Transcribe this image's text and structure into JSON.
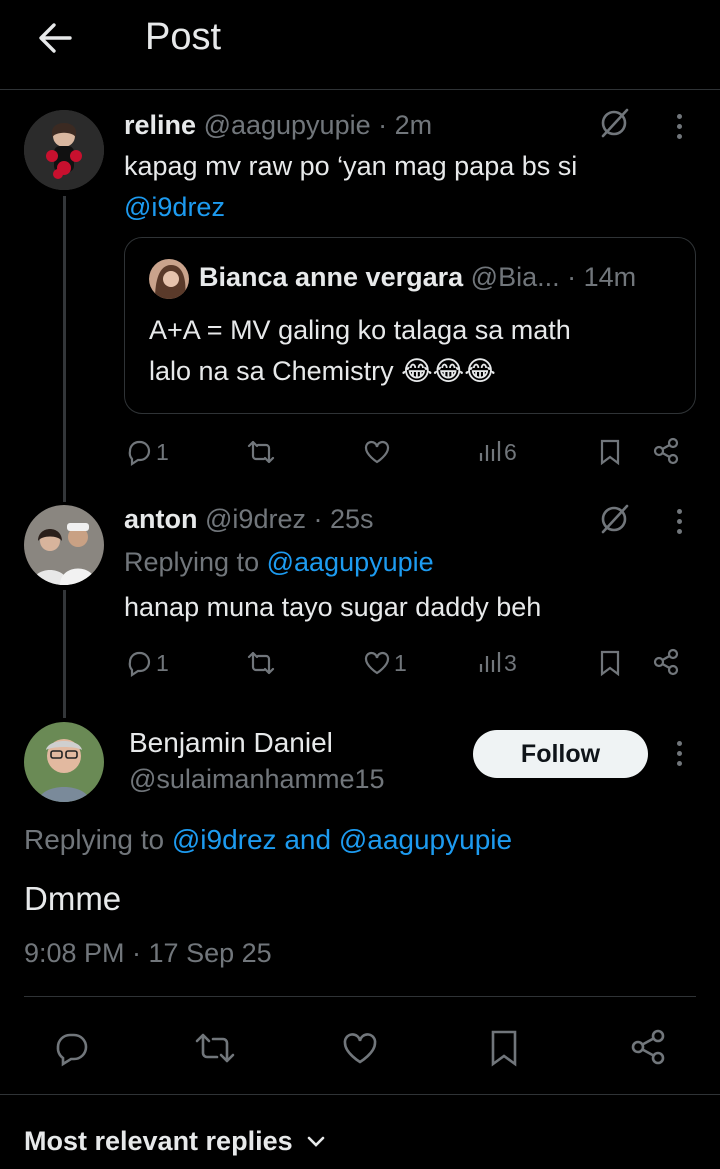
{
  "header": {
    "title": "Post"
  },
  "reply1": {
    "display_name": "reline",
    "handle": "@aagupyupie",
    "time": "· 2m",
    "text_line1": "kapag mv raw po ‘yan mag papa bs si",
    "mention": "@i9drez",
    "quote": {
      "display_name": "Bianca anne vergara",
      "handle": "@Bia...",
      "time": "· 14m",
      "text_line1": "A+A = MV galing ko talaga sa math",
      "text_line2": "lalo na sa Chemistry 😂😂😂"
    },
    "actions": {
      "replies": "1",
      "reposts": "",
      "likes": "",
      "views": "6"
    }
  },
  "reply2": {
    "display_name": "anton",
    "handle": "@i9drez",
    "time": "· 25s",
    "replying_prefix": "Replying to",
    "replying_to": "@aagupyupie",
    "text": "hanap muna tayo sugar daddy beh",
    "actions": {
      "replies": "1",
      "reposts": "",
      "likes": "1",
      "views": "3"
    }
  },
  "main": {
    "display_name": "Benjamin Daniel",
    "handle": "@sulaimanhamme15",
    "follow_label": "Follow",
    "replying_prefix": "Replying to",
    "replying_to": "@i9drez and @aagupyupie",
    "text": "Dmme",
    "timestamp": "9:08 PM · 17 Sep 25"
  },
  "footer": {
    "sort_label": "Most relevant replies"
  },
  "colors": {
    "background": "#000000",
    "text": "#e7e9ea",
    "muted": "#71767b",
    "link": "#1d9bf0",
    "border": "#2f3336"
  },
  "icons": [
    "back-arrow-icon",
    "grok-icon",
    "more-icon",
    "reply-icon",
    "repost-icon",
    "like-icon",
    "views-icon",
    "bookmark-icon",
    "share-icon",
    "chevron-down-icon"
  ]
}
